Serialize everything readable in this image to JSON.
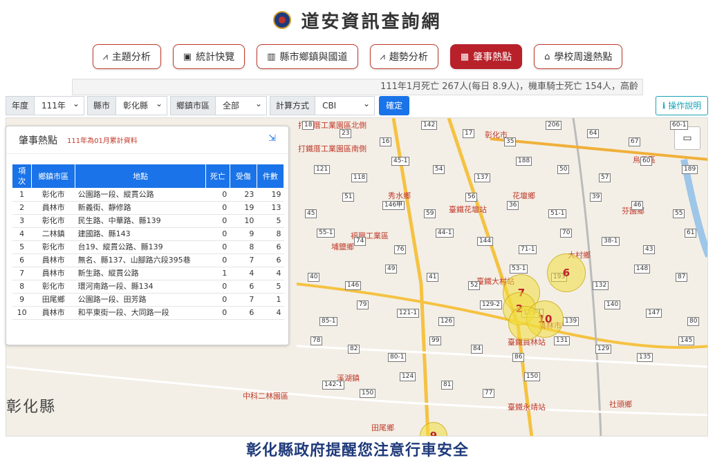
{
  "header": {
    "title": "道安資訊查詢網"
  },
  "nav": [
    {
      "label": "主題分析",
      "icon": "line-chart-icon",
      "glyph": "⩘",
      "active": false
    },
    {
      "label": "統計快覽",
      "icon": "slides-icon",
      "glyph": "▣",
      "active": false
    },
    {
      "label": "縣市鄉鎮與國道",
      "icon": "bar-chart-icon",
      "glyph": "▥",
      "active": false
    },
    {
      "label": "趨勢分析",
      "icon": "trend-icon",
      "glyph": "⩘",
      "active": false
    },
    {
      "label": "肇事熱點",
      "icon": "map-icon",
      "glyph": "▦",
      "active": true
    },
    {
      "label": "學校周邊熱點",
      "icon": "school-icon",
      "glyph": "⌂",
      "active": false
    }
  ],
  "ticker": "111年1月死亡 267人(每日 8.9人)，機車騎士死亡 154人，高齡",
  "filters": {
    "year_label": "年度",
    "year_value": "111年",
    "county_label": "縣市",
    "county_value": "彰化縣",
    "town_label": "鄉鎮市區",
    "town_value": "全部",
    "method_label": "計算方式",
    "method_value": "CBI",
    "confirm": "確定"
  },
  "help": {
    "glyph": "ℹ",
    "label": "操作說明"
  },
  "map": {
    "county": "彰化縣",
    "districts": [
      "彰化市",
      "秀水鄉",
      "花壇鄉",
      "芬園鄉",
      "大村鄉",
      "埔鹽鄉",
      "溪湖鎮",
      "員林市",
      "社頭鄉",
      "田尾鄉",
      "中科二林園區",
      "烏日區",
      "打鐵厝工業園區北側",
      "打鐵厝工業園區南側",
      "福興工業區",
      "臺鐵花壇站",
      "臺鐵大村站",
      "臺鐵員林站",
      "臺鐵永靖站"
    ],
    "roads": [
      "18",
      "23",
      "16",
      "142",
      "17",
      "35",
      "206",
      "64",
      "67",
      "60-1",
      "121",
      "118",
      "45-1",
      "54",
      "137",
      "188",
      "50",
      "57",
      "60",
      "189",
      "45",
      "51",
      "146甲",
      "59",
      "56",
      "36",
      "51-1",
      "39",
      "46",
      "55",
      "55-1",
      "74",
      "76",
      "44-1",
      "144",
      "71-1",
      "70",
      "38-1",
      "43",
      "61",
      "40",
      "146",
      "49",
      "41",
      "52",
      "53-1",
      "193",
      "132",
      "148",
      "87",
      "85-1",
      "79",
      "121-1",
      "126",
      "129-2",
      "129-1",
      "139",
      "140",
      "147",
      "80",
      "78",
      "82",
      "80-1",
      "99",
      "84",
      "86",
      "131",
      "129",
      "135",
      "145",
      "142-1",
      "150",
      "124",
      "81",
      "77",
      "150"
    ],
    "clusters": [
      {
        "label": "6"
      },
      {
        "label": "7"
      },
      {
        "label": "2"
      },
      {
        "label": "10"
      },
      {
        "label": ""
      },
      {
        "label": "9"
      }
    ],
    "layer_icon": "image-icon"
  },
  "panel": {
    "title": "肇事熱點",
    "subtitle": "111年為01月累計資料",
    "collapse_glyph": "⇲",
    "columns": [
      "項次",
      "鄉鎮市區",
      "地點",
      "死亡",
      "受傷",
      "件數"
    ],
    "rows": [
      {
        "no": "1",
        "town": "彰化市",
        "place": "公園路一段、縱貫公路",
        "death": "0",
        "injured": "23",
        "count": "19"
      },
      {
        "no": "2",
        "town": "員林市",
        "place": "新義街、靜修路",
        "death": "0",
        "injured": "19",
        "count": "13"
      },
      {
        "no": "3",
        "town": "彰化市",
        "place": "民生路、中華路、縣139",
        "death": "0",
        "injured": "10",
        "count": "5"
      },
      {
        "no": "4",
        "town": "二林鎮",
        "place": "建國路、縣143",
        "death": "0",
        "injured": "9",
        "count": "8"
      },
      {
        "no": "5",
        "town": "彰化市",
        "place": "台19、縱貫公路、縣139",
        "death": "0",
        "injured": "8",
        "count": "6"
      },
      {
        "no": "6",
        "town": "員林市",
        "place": "無名、縣137、山腳路六段395巷",
        "death": "0",
        "injured": "7",
        "count": "6"
      },
      {
        "no": "7",
        "town": "員林市",
        "place": "新生路、縱貫公路",
        "death": "1",
        "injured": "4",
        "count": "4"
      },
      {
        "no": "8",
        "town": "彰化市",
        "place": "環河南路一段、縣134",
        "death": "0",
        "injured": "6",
        "count": "5"
      },
      {
        "no": "9",
        "town": "田尾鄉",
        "place": "公園路一段、田芳路",
        "death": "0",
        "injured": "7",
        "count": "1"
      },
      {
        "no": "10",
        "town": "員林市",
        "place": "和平東街一段、大同路一段",
        "death": "0",
        "injured": "6",
        "count": "4"
      }
    ]
  },
  "footer": "彰化縣政府提醒您注意行車安全"
}
